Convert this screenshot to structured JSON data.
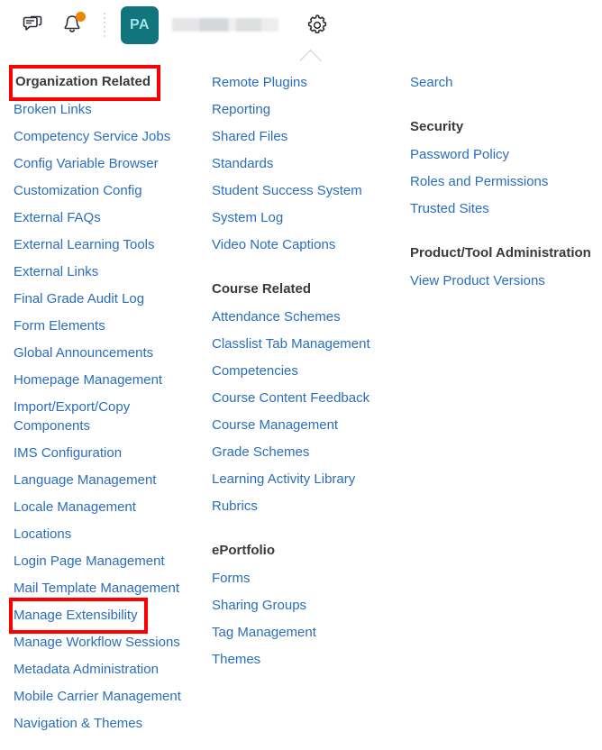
{
  "navbar": {
    "icons": [
      {
        "name": "chat-icon",
        "label": "Messages"
      },
      {
        "name": "bell-icon",
        "label": "Notifications"
      }
    ],
    "avatar_initials": "PA",
    "user_name_redacted": "",
    "gear_label": "Admin Tools"
  },
  "accent": {
    "link_blue": "#2a6ebb",
    "avatar_teal": "#12747c",
    "avatar_text": "#9fe2e8",
    "badge_orange": "#f28500",
    "highlight_red": "#fc0000",
    "heading_gray": "#3a3a3a"
  },
  "columns": [
    {
      "id": "column-1",
      "groups": [
        {
          "heading": "Organization Related",
          "heading_highlighted": true,
          "items": [
            {
              "label": "Broken Links",
              "highlighted": false
            },
            {
              "label": "Competency Service Jobs",
              "highlighted": false
            },
            {
              "label": "Config Variable Browser",
              "highlighted": false
            },
            {
              "label": "Customization Config",
              "highlighted": false
            },
            {
              "label": "External FAQs",
              "highlighted": false
            },
            {
              "label": "External Learning Tools",
              "highlighted": false
            },
            {
              "label": "External Links",
              "highlighted": false
            },
            {
              "label": "Final Grade Audit Log",
              "highlighted": false
            },
            {
              "label": "Form Elements",
              "highlighted": false
            },
            {
              "label": "Global Announcements",
              "highlighted": false
            },
            {
              "label": "Homepage Management",
              "highlighted": false
            },
            {
              "label": "Import/Export/Copy Components",
              "highlighted": false
            },
            {
              "label": "IMS Configuration",
              "highlighted": false
            },
            {
              "label": "Language Management",
              "highlighted": false
            },
            {
              "label": "Locale Management",
              "highlighted": false
            },
            {
              "label": "Locations",
              "highlighted": false
            },
            {
              "label": "Login Page Management",
              "highlighted": false
            },
            {
              "label": "Mail Template Management",
              "highlighted": false
            },
            {
              "label": "Manage Extensibility",
              "highlighted": true
            },
            {
              "label": "Manage Workflow Sessions",
              "highlighted": false
            },
            {
              "label": "Metadata Administration",
              "highlighted": false
            },
            {
              "label": "Mobile Carrier Management",
              "highlighted": false
            },
            {
              "label": "Navigation & Themes",
              "highlighted": false
            }
          ]
        }
      ]
    },
    {
      "id": "column-2",
      "groups": [
        {
          "heading": "",
          "heading_highlighted": false,
          "items": [
            {
              "label": "Remote Plugins",
              "highlighted": false
            },
            {
              "label": "Reporting",
              "highlighted": false
            },
            {
              "label": "Shared Files",
              "highlighted": false
            },
            {
              "label": "Standards",
              "highlighted": false
            },
            {
              "label": "Student Success System",
              "highlighted": false
            },
            {
              "label": "System Log",
              "highlighted": false
            },
            {
              "label": "Video Note Captions",
              "highlighted": false
            }
          ]
        },
        {
          "heading": "Course Related",
          "heading_highlighted": false,
          "items": [
            {
              "label": "Attendance Schemes",
              "highlighted": false
            },
            {
              "label": "Classlist Tab Management",
              "highlighted": false
            },
            {
              "label": "Competencies",
              "highlighted": false
            },
            {
              "label": "Course Content Feedback",
              "highlighted": false
            },
            {
              "label": "Course Management",
              "highlighted": false
            },
            {
              "label": "Grade Schemes",
              "highlighted": false
            },
            {
              "label": "Learning Activity Library",
              "highlighted": false
            },
            {
              "label": "Rubrics",
              "highlighted": false
            }
          ]
        },
        {
          "heading": "ePortfolio",
          "heading_highlighted": false,
          "items": [
            {
              "label": "Forms",
              "highlighted": false
            },
            {
              "label": "Sharing Groups",
              "highlighted": false
            },
            {
              "label": "Tag Management",
              "highlighted": false
            },
            {
              "label": "Themes",
              "highlighted": false
            }
          ]
        }
      ]
    },
    {
      "id": "column-3",
      "groups": [
        {
          "heading": "",
          "heading_highlighted": false,
          "items": [
            {
              "label": "Search",
              "highlighted": false
            }
          ]
        },
        {
          "heading": "Security",
          "heading_highlighted": false,
          "items": [
            {
              "label": "Password Policy",
              "highlighted": false
            },
            {
              "label": "Roles and Permissions",
              "highlighted": false
            },
            {
              "label": "Trusted Sites",
              "highlighted": false
            }
          ]
        },
        {
          "heading": "Product/Tool Administration",
          "heading_highlighted": false,
          "items": [
            {
              "label": "View Product Versions",
              "highlighted": false
            }
          ]
        }
      ]
    }
  ]
}
